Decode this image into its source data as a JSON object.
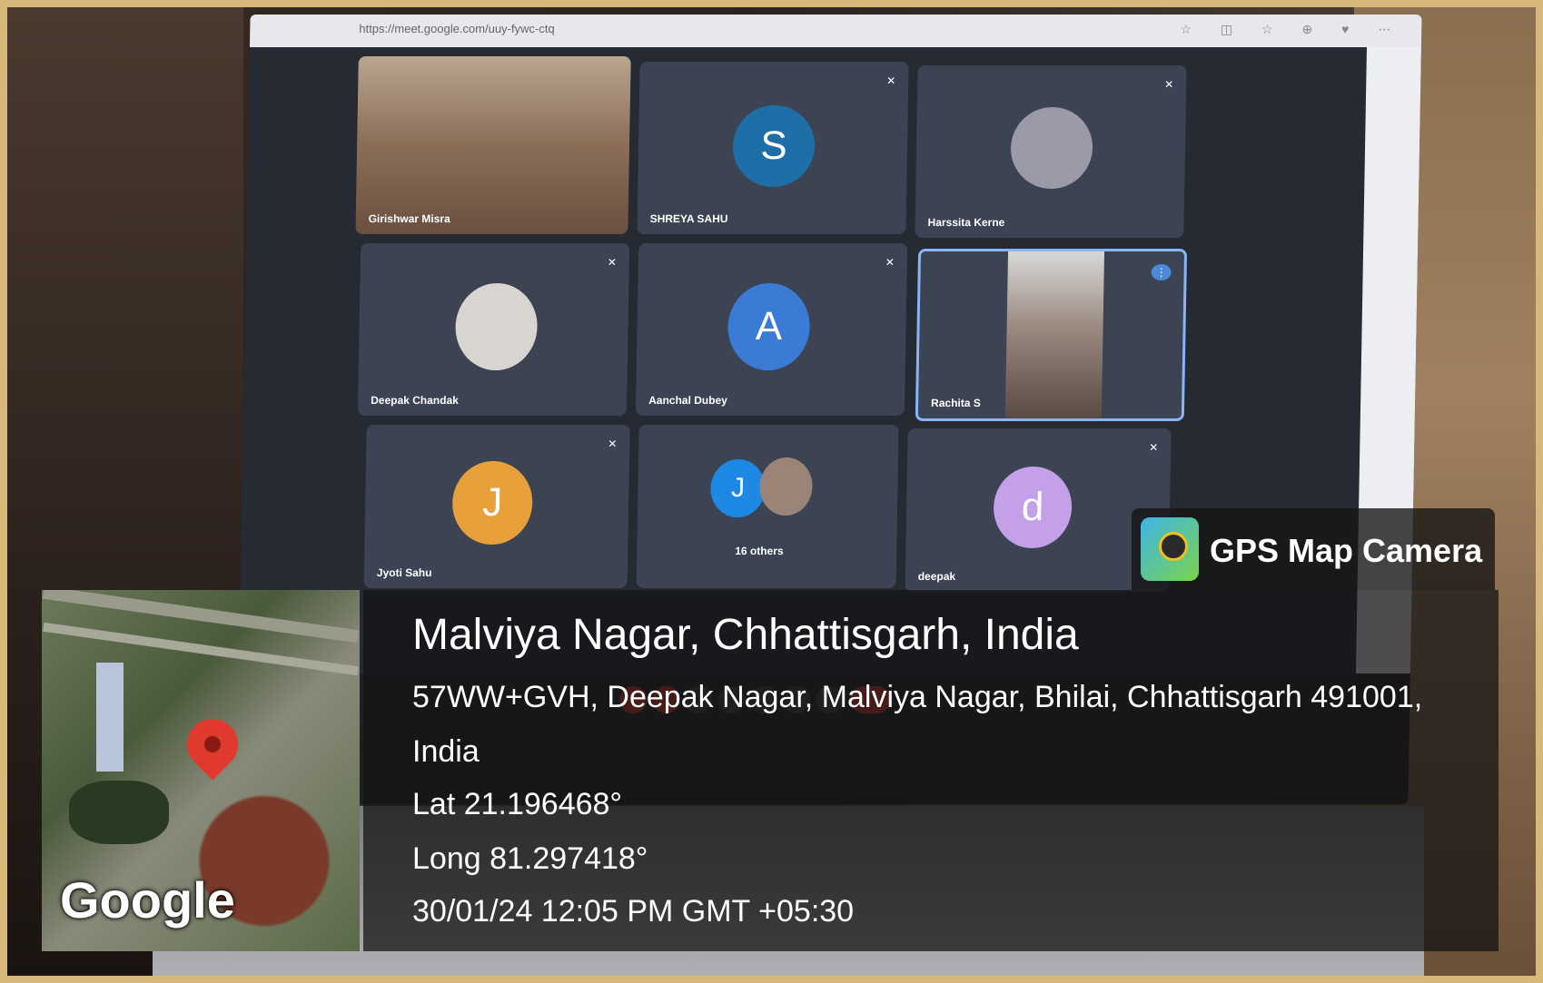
{
  "browser": {
    "url": "https://meet.google.com/uuy-fywc-ctq"
  },
  "participants": [
    {
      "name": "Girishwar Misra",
      "type": "video",
      "muted": false
    },
    {
      "name": "SHREYA SAHU",
      "type": "avatar",
      "initial": "S",
      "color": "#1e6fa8",
      "muted": true
    },
    {
      "name": "Harssita Kerne",
      "type": "photo",
      "muted": true
    },
    {
      "name": "Deepak Chandak",
      "type": "photo",
      "muted": true
    },
    {
      "name": "Aanchal Dubey",
      "type": "avatar",
      "initial": "A",
      "color": "#3a7bd5",
      "muted": true
    },
    {
      "name": "Rachita S",
      "type": "video",
      "muted": false,
      "speaking": true
    },
    {
      "name": "Jyoti Sahu",
      "type": "avatar",
      "initial": "J",
      "color": "#e8a13a",
      "muted": true
    },
    {
      "name": "16 others",
      "type": "group",
      "initial": "J",
      "color": "#1e88e5"
    },
    {
      "name": "deepak",
      "type": "avatar",
      "initial": "d",
      "color": "#c4a0e8",
      "muted": true
    }
  ],
  "overlay": {
    "brand": "GPS Map Camera",
    "map_label": "Google",
    "place": "Malviya Nagar, Chhattisgarh, India",
    "address": "57WW+GVH, Deepak Nagar, Malviya Nagar, Bhilai, Chhattisgarh 491001, India",
    "lat": "Lat 21.196468°",
    "long": "Long 81.297418°",
    "datetime": "30/01/24 12:05 PM GMT +05:30"
  },
  "colors": {
    "frame": "#d8b878",
    "meet_bg": "#262a33",
    "tile_bg": "#3c4352",
    "active_border": "#8ab4f8",
    "end_call": "#d93025"
  }
}
